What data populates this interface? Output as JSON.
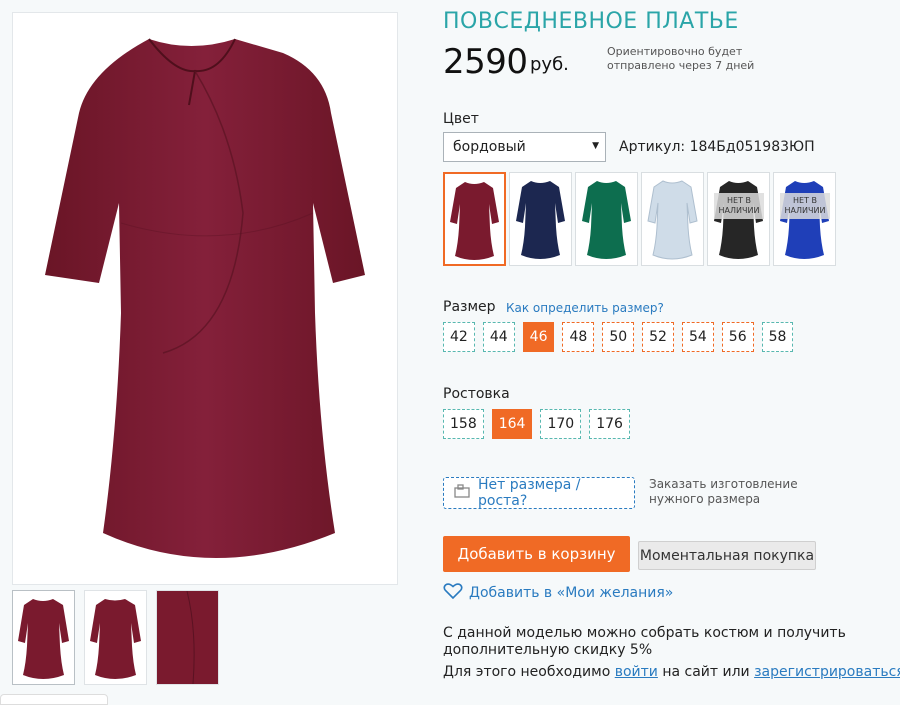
{
  "product": {
    "title": "ПОВСЕДНЕВНОЕ ПЛАТЬЕ",
    "price": "2590",
    "currency": "руб.",
    "shipping_note": "Ориентировочно будет отправлено через 7 дней",
    "main_color": "#7a1a2e"
  },
  "color": {
    "label": "Цвет",
    "selected": "бордовый",
    "article_label": "Артикул:",
    "article_value": "184Бд051983ЮП",
    "swatches": [
      {
        "hex": "#7a1a2e",
        "available": true,
        "selected": true
      },
      {
        "hex": "#1c2750",
        "available": true,
        "selected": false
      },
      {
        "hex": "#0d6e4f",
        "available": true,
        "selected": false
      },
      {
        "hex": "#cfdce8",
        "available": true,
        "selected": false
      },
      {
        "hex": "#262626",
        "available": false,
        "selected": false
      },
      {
        "hex": "#1f3fb8",
        "available": false,
        "selected": false
      }
    ],
    "out_of_stock_text": "НЕТ В НАЛИЧИИ"
  },
  "size": {
    "label": "Размер",
    "help_link": "Как определить размер?",
    "options": [
      "42",
      "44",
      "46",
      "48",
      "50",
      "52",
      "54",
      "56",
      "58"
    ],
    "selected": "46"
  },
  "height": {
    "label": "Ростовка",
    "options": [
      "158",
      "164",
      "170",
      "176"
    ],
    "selected": "164"
  },
  "custom": {
    "no_size_button": "Нет размера / роста?",
    "order_note": "Заказать изготовление нужного размера"
  },
  "actions": {
    "add_to_cart": "Добавить в корзину",
    "instant_buy": "Моментальная покупка",
    "wishlist": "Добавить в «Мои желания»"
  },
  "promo": {
    "costume_text": "С данной моделью можно собрать костюм и получить дополнительную скидку 5%",
    "login_prefix": "Для этого необходимо",
    "login_link": "войти",
    "login_middle": "на сайт или",
    "register_link": "зарегистрироваться"
  }
}
